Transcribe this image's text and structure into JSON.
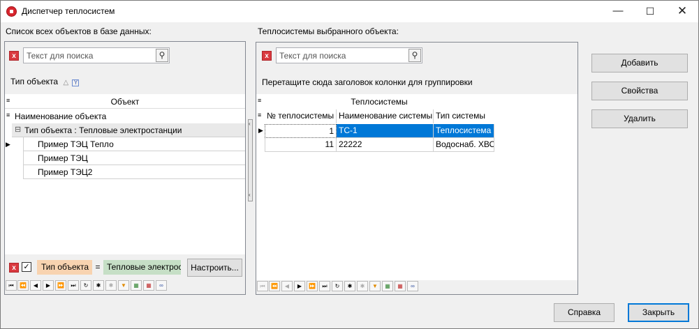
{
  "window": {
    "title": "Диспетчер теплосистем"
  },
  "left": {
    "label": "Список всех объектов в базе данных:",
    "search_placeholder": "Текст для поиска",
    "group_chip": "Тип объекта",
    "column_header": "Объект",
    "column_name": "Наименование объекта",
    "group_row": "Тип объекта : Тепловые электростанции",
    "items": [
      "Пример ТЭЦ Тепло",
      "Пример ТЭЦ",
      "Пример ТЭЦ2"
    ],
    "filter": {
      "field": "Тип объекта",
      "op": "=",
      "value": "Тепловые электрос",
      "checked": true
    },
    "configure_label": "Настроить..."
  },
  "right": {
    "label": "Теплосистемы выбранного объекта:",
    "search_placeholder": "Текст для поиска",
    "group_hint": "Перетащите сюда заголовок колонки для группировки",
    "band_header": "Теплосистемы",
    "columns": [
      "№ теплосистемы",
      "Наименование системы",
      "Тип системы"
    ],
    "rows": [
      {
        "num": "1",
        "name": "ТС-1",
        "type": "Теплосистема",
        "selected": true
      },
      {
        "num": "11",
        "name": "22222",
        "type": "Водоснаб. ХВС",
        "selected": false
      }
    ]
  },
  "buttons": {
    "add": "Добавить",
    "properties": "Свойства",
    "delete": "Удалить",
    "help": "Справка",
    "close": "Закрыть"
  },
  "colors": {
    "selection": "#0078d7",
    "filter_field": "#f8d3b0",
    "filter_value": "#c6dfc6",
    "accent_close": "#0078d7"
  }
}
